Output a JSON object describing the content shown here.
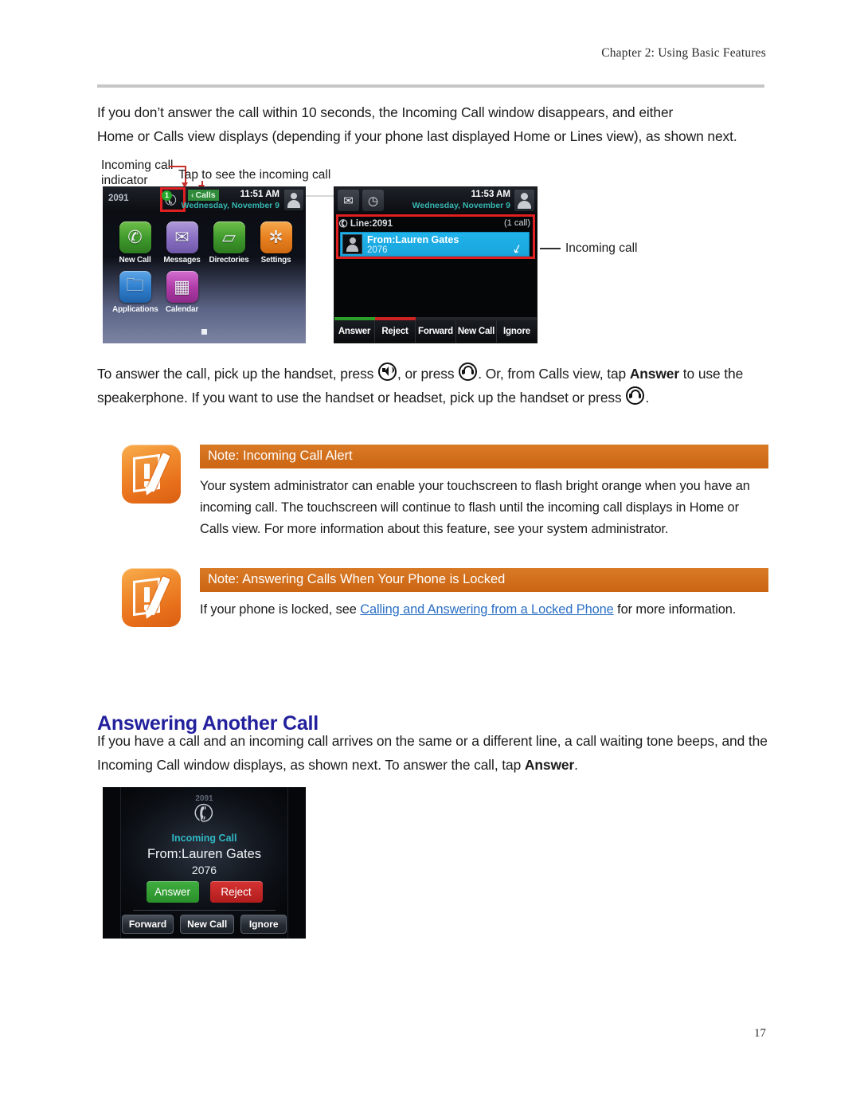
{
  "header": {
    "chapter": "Chapter 2: Using Basic Features"
  },
  "paragraphs": {
    "p1_line1": "If you don’t answer the call within 10 seconds, the Incoming Call window disappears, and either",
    "p1_line2": "Home or Calls view displays (depending if your phone last displayed Home or Lines view), as shown next.",
    "p2_a": "To answer the call, pick up the handset, press ",
    "p2_b": ", or press ",
    "p2_c": ". Or, from Calls view, tap ",
    "p2_answer": "Answer",
    "p2_d": " to use the speakerphone. If you want to use the handset or headset, pick up the handset or press ",
    "p2_e": ".",
    "p3_a": "If you have a call and an incoming call arrives on the same or a different line, a call waiting tone beeps, and the Incoming Call window displays, as shown next. To answer the call, tap ",
    "p3_answer": "Answer",
    "p3_b": "."
  },
  "heading": {
    "answering_another_call": "Answering Another Call"
  },
  "notes": [
    {
      "title": "Note: Incoming Call Alert",
      "body": "Your system administrator can enable your touchscreen to flash bright orange when you have an incoming call. The touchscreen will continue to flash until the incoming call displays in Home or Calls view. For more information about this feature, see your system administrator.",
      "icon": "note-pencil-icon"
    },
    {
      "title": "Note: Answering Calls When Your Phone is Locked",
      "body_before": "If your phone is locked, see ",
      "link": "Calling and Answering from a Locked Phone",
      "body_after": " for more information.",
      "icon": "note-pencil-icon"
    }
  ],
  "figure_top": {
    "callout_indicator": "Incoming call\nindicator",
    "callout_tap": "Tap to see the incoming call",
    "callout_incoming": "Incoming call",
    "home_view": {
      "extension": "2091",
      "call_count_badge": "1",
      "calls_tab": "Calls",
      "calls_tab_chevron": "‹",
      "time": "11:51 AM",
      "date": "Wednesday, November 9",
      "apps": [
        {
          "label": "New Call",
          "icon": "handset-icon",
          "glyph": "✆"
        },
        {
          "label": "Messages",
          "icon": "envelope-icon",
          "glyph": "✉"
        },
        {
          "label": "Directories",
          "icon": "open-book-icon",
          "glyph": "▱"
        },
        {
          "label": "Settings",
          "icon": "gear-icon",
          "glyph": "✲"
        },
        {
          "label": "Applications",
          "icon": "folder-a-icon",
          "glyph": "🗀"
        },
        {
          "label": "Calendar",
          "icon": "calendar-icon",
          "glyph": "▦"
        }
      ]
    },
    "calls_view": {
      "time": "11:53 AM",
      "date": "Wednesday, November 9",
      "line_label": "Line:2091",
      "call_count": "(1 call)",
      "caller_name": "From:Lauren Gates",
      "caller_number": "2076",
      "softkeys": [
        "Answer",
        "Reject",
        "Forward",
        "New Call",
        "Ignore"
      ],
      "status_icons": [
        "envelope-icon",
        "clock-icon"
      ]
    }
  },
  "figure_bottom": {
    "extension": "2091",
    "status": "Incoming Call",
    "caller_name": "From:Lauren Gates",
    "caller_number": "2076",
    "primary_buttons": [
      "Answer",
      "Reject"
    ],
    "soft_buttons": [
      "Forward",
      "New Call",
      "Ignore"
    ]
  },
  "footer": {
    "page_number": "17"
  },
  "colors": {
    "heading_blue": "#22209c",
    "note_orange": "#cb6512",
    "link_blue": "#2b6fc4",
    "callout_red": "#c9302c",
    "phone_cyan": "#21b4ec",
    "answer_green": "#2a8f2a",
    "reject_red": "#b11c1c"
  }
}
